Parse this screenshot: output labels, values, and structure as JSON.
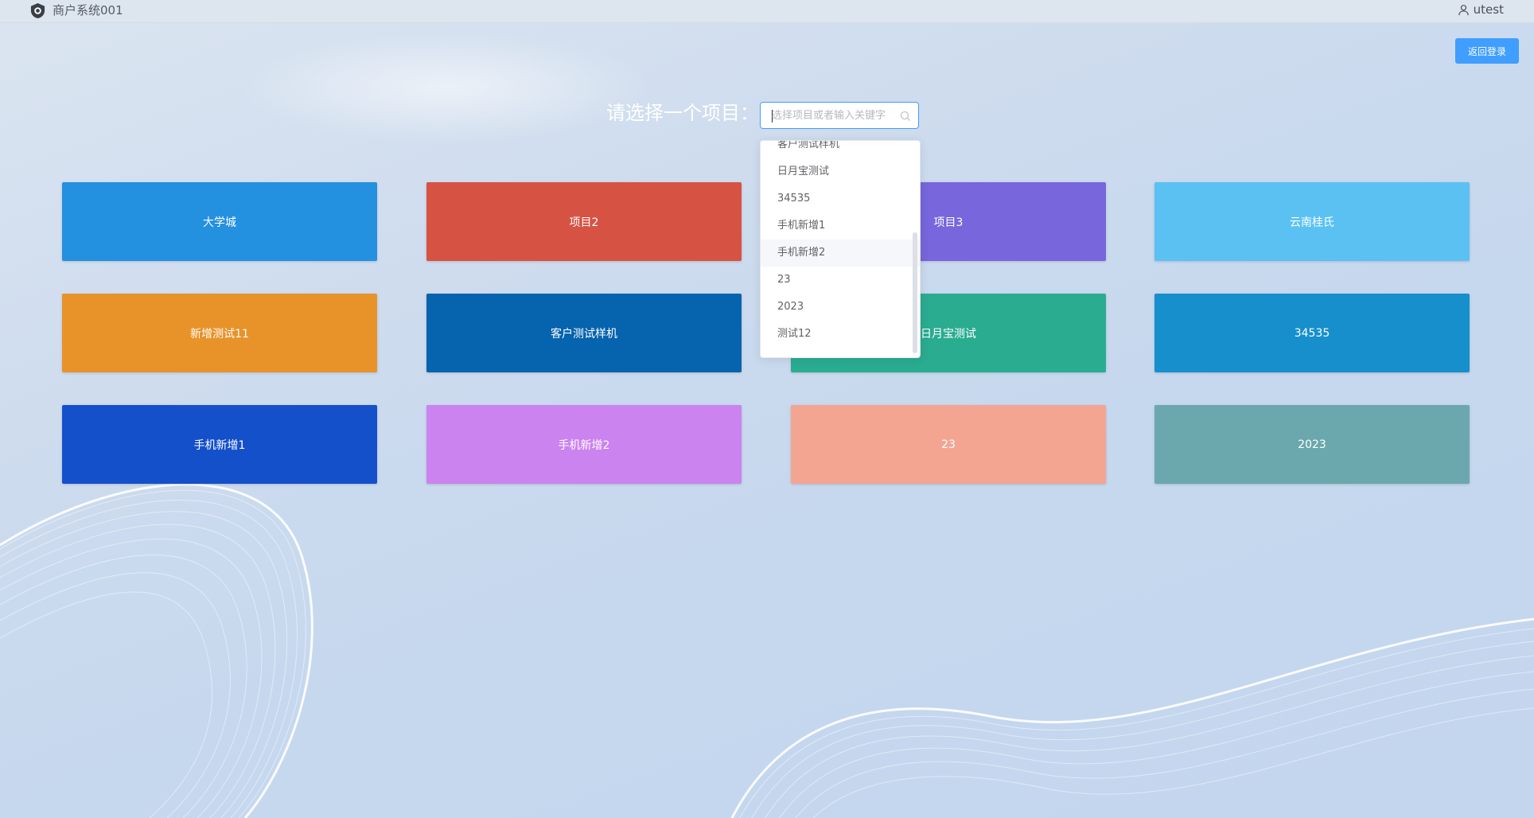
{
  "header": {
    "app_title": "商户系统001",
    "logo_icon": "shield-logo-icon",
    "user_icon": "user-icon",
    "username": "utest"
  },
  "back_button": {
    "label": "返回登录",
    "color": "#409eff"
  },
  "selector": {
    "label": "请选择一个项目：",
    "placeholder": "选择项目或者输入关键字",
    "search_icon": "search-icon"
  },
  "dropdown": {
    "items": [
      "客户测试样机",
      "日月宝测试",
      "34535",
      "手机新增1",
      "手机新增2",
      "23",
      "2023",
      "测试12"
    ],
    "hovered": "手机新增2"
  },
  "projects": [
    {
      "name": "大学城",
      "color": "#2490e0"
    },
    {
      "name": "项目2",
      "color": "#d65344"
    },
    {
      "name": "项目3",
      "color": "#7766dc"
    },
    {
      "name": "云南桂氏",
      "color": "#5bc1f3"
    },
    {
      "name": "新增测试11",
      "color": "#e8932a"
    },
    {
      "name": "客户测试样机",
      "color": "#0663ae"
    },
    {
      "name": "日月宝测试",
      "color": "#2aac91"
    },
    {
      "name": "34535",
      "color": "#168fcc"
    },
    {
      "name": "手机新增1",
      "color": "#1550cb"
    },
    {
      "name": "手机新增2",
      "color": "#cb83f0"
    },
    {
      "name": "23",
      "color": "#f3a592"
    },
    {
      "name": "2023",
      "color": "#6ba8ad"
    }
  ]
}
